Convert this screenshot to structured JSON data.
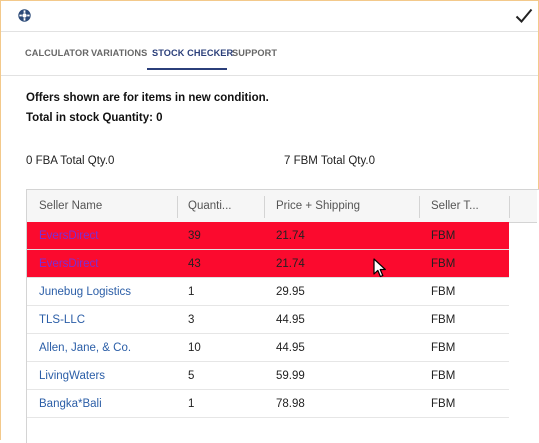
{
  "window": {
    "app_icon": "addon-gear-icon",
    "confirm_icon": "check-icon"
  },
  "tabs": [
    {
      "label": "CALCULATOR",
      "active": false
    },
    {
      "label": "VARIATIONS",
      "active": false
    },
    {
      "label": "STOCK CHECKER",
      "active": true
    },
    {
      "label": "SUPPORT",
      "active": false
    }
  ],
  "info": {
    "condition_note": "Offers shown are for items in new condition.",
    "total_stock": "Total in stock Quantity: 0",
    "fba_total": "0 FBA Total Qty.0",
    "fbm_total": "7 FBM Total Qty.0"
  },
  "table": {
    "columns": [
      "Seller Name",
      "Quanti...",
      "Price + Shipping",
      "Seller T..."
    ],
    "rows": [
      {
        "seller": "EversDirect",
        "quantity": "39",
        "price": "21.74",
        "type": "FBM",
        "highlighted": true
      },
      {
        "seller": "EversDirect",
        "quantity": "43",
        "price": "21.74",
        "type": "FBM",
        "highlighted": true
      },
      {
        "seller": "Junebug Logistics",
        "quantity": "1",
        "price": "29.95",
        "type": "FBM",
        "highlighted": false
      },
      {
        "seller": "TLS-LLC",
        "quantity": "3",
        "price": "44.95",
        "type": "FBM",
        "highlighted": false
      },
      {
        "seller": "Allen, Jane, & Co.",
        "quantity": "10",
        "price": "44.95",
        "type": "FBM",
        "highlighted": false
      },
      {
        "seller": "LivingWaters",
        "quantity": "5",
        "price": "59.99",
        "type": "FBM",
        "highlighted": false
      },
      {
        "seller": "Bangka*Bali",
        "quantity": "1",
        "price": "78.98",
        "type": "FBM",
        "highlighted": false
      }
    ]
  },
  "colors": {
    "highlight_row": "#fb0a2e",
    "active_tab": "#2b3f7a",
    "seller_link": "#2b5ea7",
    "frame_border": "#f3c98b"
  }
}
